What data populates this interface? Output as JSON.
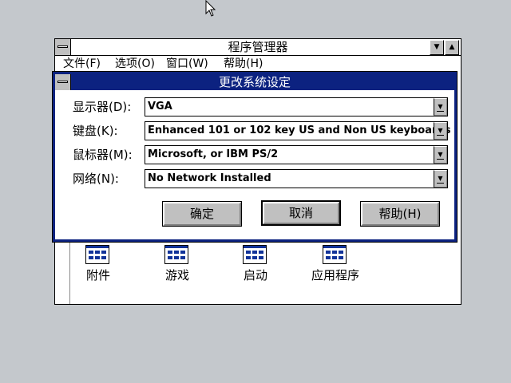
{
  "program_manager": {
    "title": "程序管理器",
    "menu": [
      "文件(F)",
      "选项(O)",
      "窗口(W)",
      "帮助(H)"
    ],
    "groups": [
      "附件",
      "游戏",
      "启动",
      "应用程序"
    ]
  },
  "dialog": {
    "title": "更改系统设定",
    "fields": [
      {
        "label": "显示器(D):",
        "value": "VGA"
      },
      {
        "label": "键盘(K):",
        "value": "Enhanced 101 or 102 key US and Non US keyboards"
      },
      {
        "label": "鼠标器(M):",
        "value": "Microsoft, or IBM PS/2"
      },
      {
        "label": "网络(N):",
        "value": "No Network Installed"
      }
    ],
    "buttons": {
      "ok": "确定",
      "cancel": "取消",
      "help": "帮助(H)"
    }
  },
  "colors": {
    "desktop": "#c4c8cc",
    "title_active": "#0c2280",
    "face": "#c0c0c0"
  },
  "icons": {
    "cursor": "arrow-cursor-icon",
    "system_menu": "system-menu-icon",
    "dropdown": "dropdown-arrow-icon",
    "group": "program-group-icon"
  }
}
